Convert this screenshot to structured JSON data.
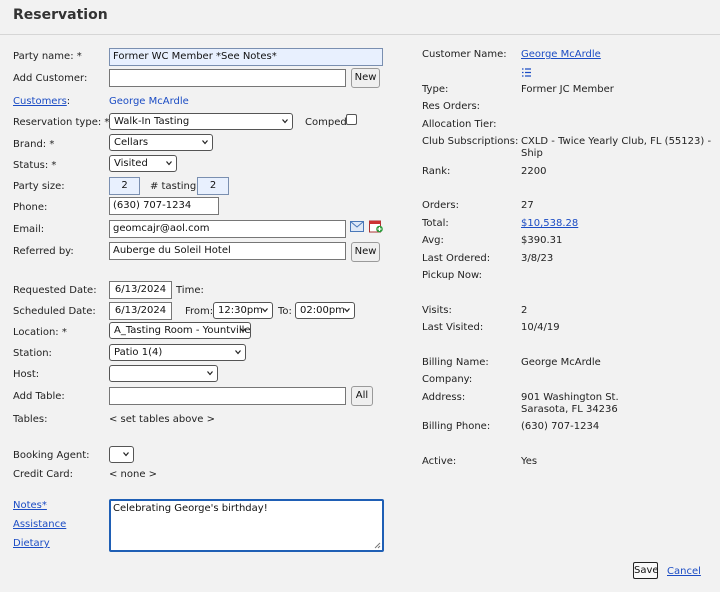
{
  "title": "Reservation",
  "form": {
    "party_name": {
      "label": "Party name: *",
      "value": "Former WC Member *See Notes*"
    },
    "add_customer": {
      "label": "Add Customer:",
      "value": "",
      "button": "New"
    },
    "customers": {
      "label": "Customers",
      "colon": ":",
      "value": "George McArdle"
    },
    "reservation_type": {
      "label": "Reservation type: *",
      "value": "Walk-In Tasting",
      "comped_label": "Comped:"
    },
    "brand": {
      "label": "Brand: *",
      "value": "Cellars"
    },
    "status": {
      "label": "Status: *",
      "value": "Visited"
    },
    "party_size": {
      "label": "Party size:",
      "value": "2",
      "tasting_label": "# tasting:",
      "tasting_value": "2"
    },
    "phone": {
      "label": "Phone:",
      "value": "(630) 707-1234"
    },
    "email": {
      "label": "Email:",
      "value": "geomcajr@aol.com"
    },
    "referred_by": {
      "label": "Referred by:",
      "value": "Auberge du Soleil Hotel",
      "button": "New"
    },
    "requested_date": {
      "label": "Requested Date:",
      "value": "6/13/2024",
      "time_label": "Time:"
    },
    "scheduled_date": {
      "label": "Scheduled Date:",
      "value": "6/13/2024",
      "from_label": "From:",
      "from_value": "12:30pm",
      "to_label": "To:",
      "to_value": "02:00pm"
    },
    "location": {
      "label": "Location: *",
      "value": "A_Tasting Room - Yountville"
    },
    "station": {
      "label": "Station:",
      "value": "Patio 1(4)"
    },
    "host": {
      "label": "Host:",
      "value": ""
    },
    "add_table": {
      "label": "Add Table:",
      "value": "",
      "button": "All"
    },
    "tables": {
      "label": "Tables:",
      "value": "< set tables above >"
    },
    "booking_agent": {
      "label": "Booking Agent:",
      "value": ""
    },
    "credit_card": {
      "label": "Credit Card:",
      "value": "< none >"
    },
    "notes": {
      "label": "Notes*",
      "value": "Celebrating George's birthday!"
    },
    "assistance": {
      "label": "Assistance"
    },
    "dietary": {
      "label": "Dietary"
    }
  },
  "customer": {
    "customer_name": {
      "label": "Customer Name:",
      "value": "George McArdle"
    },
    "type": {
      "label": "Type:",
      "value": "Former JC Member"
    },
    "res_orders": {
      "label": "Res Orders:",
      "value": ""
    },
    "allocation_tier": {
      "label": "Allocation Tier:",
      "value": ""
    },
    "club_subscriptions": {
      "label": "Club Subscriptions:",
      "value_line1": "CXLD - Twice Yearly Club, FL (55123) -",
      "value_line2": "Ship"
    },
    "rank": {
      "label": "Rank:",
      "value": "2200"
    },
    "orders": {
      "label": "Orders:",
      "value": "27"
    },
    "total": {
      "label": "Total:",
      "value": "$10,538.28"
    },
    "avg": {
      "label": "Avg:",
      "value": "$390.31"
    },
    "last_ordered": {
      "label": "Last Ordered:",
      "value": "3/8/23"
    },
    "pickup_now": {
      "label": "Pickup Now:",
      "value": ""
    },
    "visits": {
      "label": "Visits:",
      "value": "2"
    },
    "last_visited": {
      "label": "Last Visited:",
      "value": "10/4/19"
    },
    "billing_name": {
      "label": "Billing Name:",
      "value": "George McArdle"
    },
    "company": {
      "label": "Company:",
      "value": ""
    },
    "address": {
      "label": "Address:",
      "line1": "901 Washington St.",
      "line2": "Sarasota, FL 34236"
    },
    "billing_phone": {
      "label": "Billing Phone:",
      "value": "(630) 707-1234"
    },
    "active": {
      "label": "Active:",
      "value": "Yes"
    }
  },
  "actions": {
    "save": "Save",
    "cancel": "Cancel"
  }
}
